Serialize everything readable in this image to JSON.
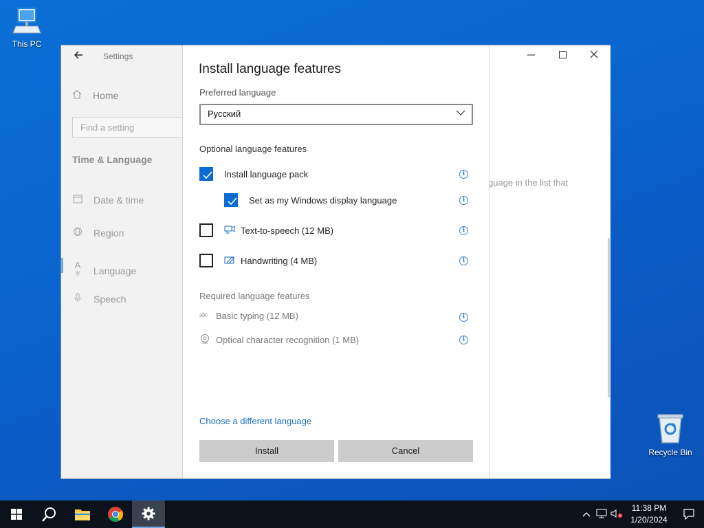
{
  "desktop": {
    "this_pc_label": "This PC",
    "recycle_bin_label": "Recycle Bin"
  },
  "settings": {
    "app_title": "Settings",
    "home_label": "Home",
    "search_placeholder": "Find a setting",
    "section_title": "Time & Language",
    "nav_items": [
      {
        "label": "Date & time",
        "icon": "calendar-clock-icon"
      },
      {
        "label": "Region",
        "icon": "globe-icon"
      },
      {
        "label": "Language",
        "icon": "language-icon",
        "active": true
      },
      {
        "label": "Speech",
        "icon": "microphone-icon"
      }
    ],
    "content_text": "guage in the list that"
  },
  "dialog": {
    "title": "Install language features",
    "preferred_label": "Preferred language",
    "selected_language": "Русский",
    "optional_label": "Optional language features",
    "optional_features": [
      {
        "label": "Install language pack",
        "checked": true
      },
      {
        "label": "Set as my Windows display language",
        "checked": true
      },
      {
        "label": "Text-to-speech (12 MB)",
        "checked": false,
        "icon": "text-to-speech-icon"
      },
      {
        "label": "Handwriting (4 MB)",
        "checked": false,
        "icon": "handwriting-icon"
      }
    ],
    "required_label": "Required language features",
    "required_features": [
      {
        "label": "Basic typing (12 MB)",
        "icon": "abc-icon"
      },
      {
        "label": "Optical character recognition (1 MB)",
        "icon": "ocr-icon"
      }
    ],
    "link_label": "Choose a different language",
    "install_label": "Install",
    "cancel_label": "Cancel"
  },
  "taskbar": {
    "time": "11:38 PM",
    "date": "1/20/2024"
  },
  "colors": {
    "accent": "#0a6cd0",
    "link": "#1b6fbb",
    "desktop": "#0a6fd6",
    "taskbar": "#0c121c"
  }
}
